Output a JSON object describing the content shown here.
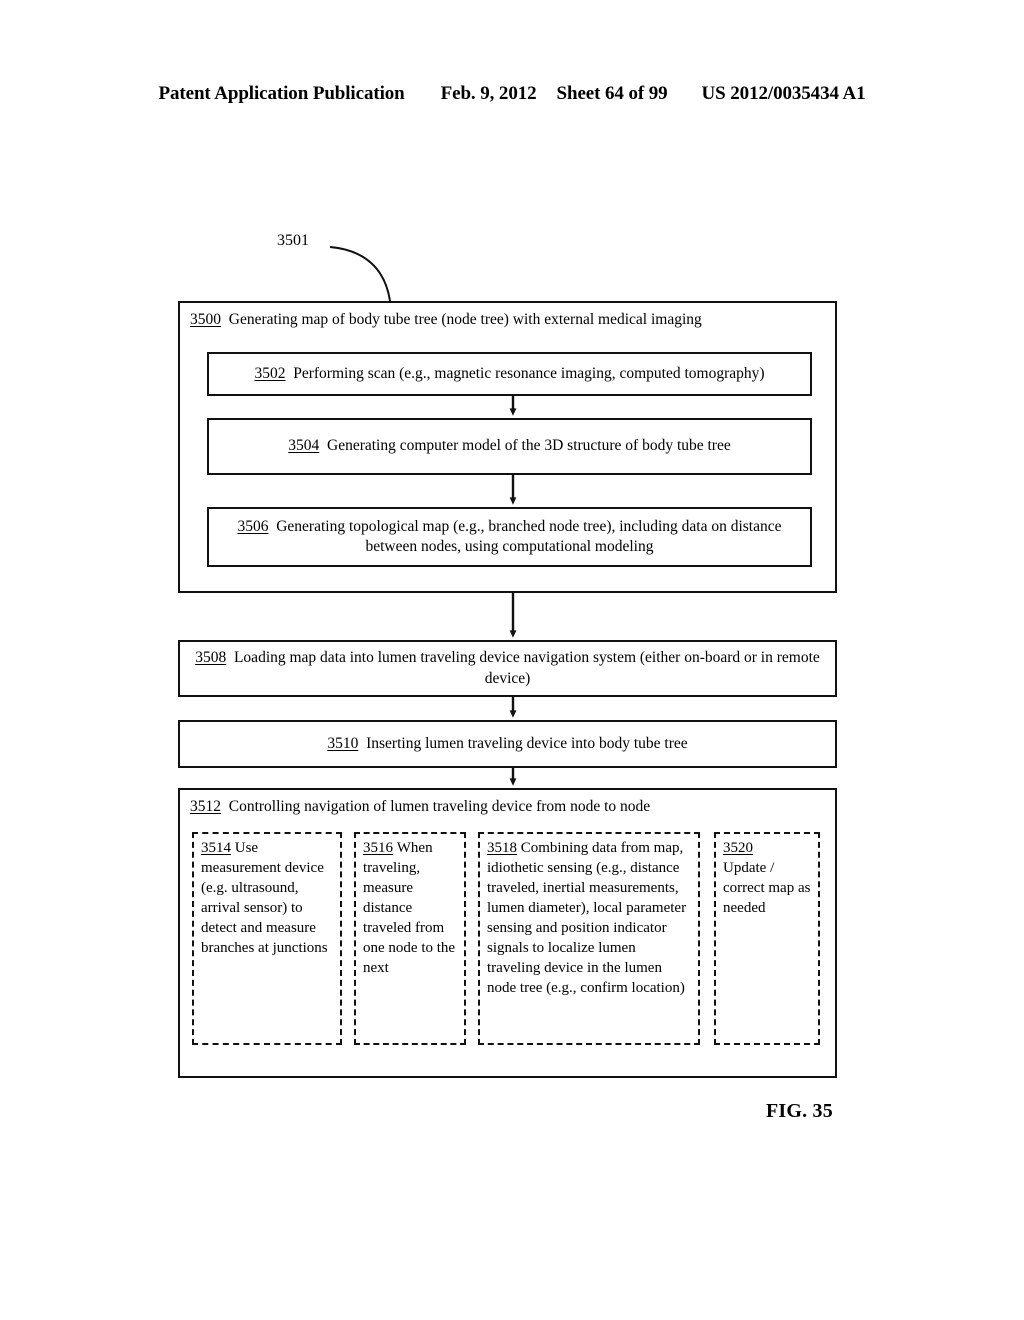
{
  "header": {
    "publication": "Patent Application Publication",
    "date": "Feb. 9, 2012",
    "sheet": "Sheet 64 of 99",
    "patent_number": "US 2012/0035434 A1"
  },
  "figure": {
    "caption": "FIG. 35",
    "callout_label": "3501"
  },
  "flowchart": {
    "outer_group": {
      "ref": "3500",
      "text": "Generating map of body tube tree (node tree) with external medical imaging"
    },
    "steps": [
      {
        "ref": "3502",
        "text": "Performing scan (e.g., magnetic resonance imaging, computed tomography)"
      },
      {
        "ref": "3504",
        "text": "Generating computer model of the 3D structure of body tube tree"
      },
      {
        "ref": "3506",
        "text": "Generating topological map (e.g., branched node tree), including data on distance between nodes, using computational modeling"
      },
      {
        "ref": "3508",
        "text": "Loading map data into lumen traveling device navigation system (either on-board or in remote device)"
      },
      {
        "ref": "3510",
        "text": "Inserting lumen traveling device into body tube tree"
      }
    ],
    "control_group": {
      "ref": "3512",
      "text": "Controlling navigation of lumen traveling device from node to node"
    },
    "substeps": [
      {
        "ref": "3514",
        "text": "Use measurement device (e.g. ultrasound, arrival sensor) to detect and measure branches at junctions"
      },
      {
        "ref": "3516",
        "text": "When traveling, measure distance traveled from one node to the next"
      },
      {
        "ref": "3518",
        "text": "Combining data from map, idiothetic sensing (e.g., distance traveled, inertial measurements, lumen diameter), local parameter sensing and position indicator signals to localize lumen traveling device in the lumen node tree (e.g., confirm location)"
      },
      {
        "ref": "3520",
        "text": "Update / correct map as needed"
      }
    ]
  },
  "colors": {
    "ink": "#111111",
    "paper": "#ffffff"
  }
}
